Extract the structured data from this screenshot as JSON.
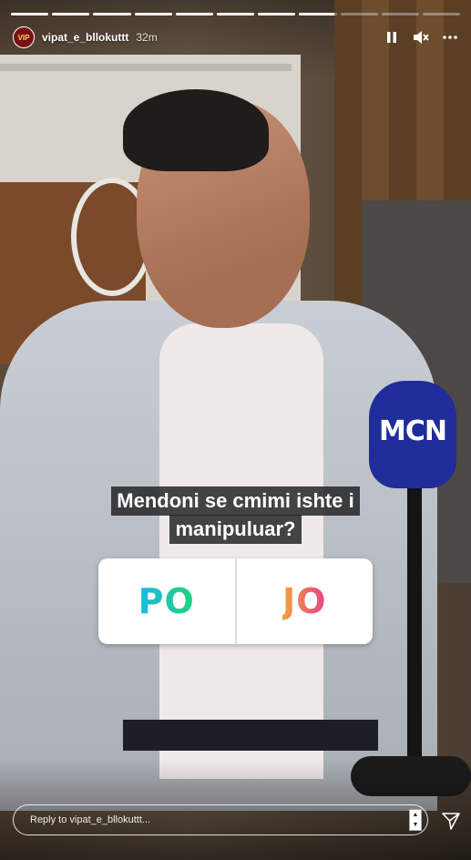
{
  "progress": {
    "segments": [
      1,
      1,
      1,
      1,
      1,
      1,
      1,
      0.95,
      0,
      0,
      0
    ],
    "bar_color": "#ffffff"
  },
  "header": {
    "avatar_text": "VIP",
    "username": "vipat_e_bllokuttt",
    "time": "32m",
    "icons": [
      "pause-icon",
      "mute-icon",
      "more-icon"
    ]
  },
  "scene": {
    "mic_label": "MCN"
  },
  "question": {
    "line1": "Mendoni se cmimi ishte i",
    "line2": "manipuluar?"
  },
  "poll": {
    "option_a": "PO",
    "option_b": "JO"
  },
  "reply": {
    "placeholder": "Reply to vipat_e_bllokuttt..."
  },
  "colors": {
    "po_gradient": [
      "#19b8e6",
      "#1ed67a"
    ],
    "jo_gradient": [
      "#f4a23a",
      "#e8408a"
    ],
    "mic": "#1f2c9a"
  }
}
